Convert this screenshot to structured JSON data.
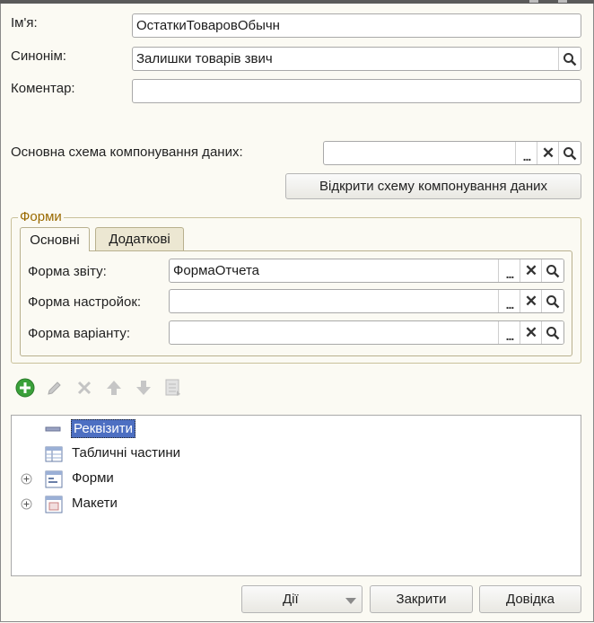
{
  "form": {
    "name_label": "Ім'я:",
    "name_value": "ОстаткиТоваровОбычн",
    "synonym_label": "Синонім:",
    "synonym_value": "Залишки товарів звич",
    "comment_label": "Коментар:",
    "comment_value": "",
    "schema_label": "Основна схема компонування даних:",
    "schema_value": "",
    "open_schema_button": "Відкрити схему компонування даних"
  },
  "forms_group": {
    "title": "Форми",
    "tabs": [
      {
        "label": "Основні",
        "active": true
      },
      {
        "label": "Додаткові",
        "active": false
      }
    ],
    "fields": [
      {
        "label": "Форма звіту:",
        "value": "ФормаОтчета"
      },
      {
        "label": "Форма настройок:",
        "value": ""
      },
      {
        "label": "Форма варіанту:",
        "value": ""
      }
    ]
  },
  "toolbar": {
    "icons": [
      "add-icon",
      "edit-icon",
      "delete-icon",
      "move-up-icon",
      "move-down-icon",
      "sort-icon"
    ]
  },
  "tree": {
    "items": [
      {
        "label": "Реквізити",
        "selected": true,
        "expandable": false
      },
      {
        "label": "Табличні частини",
        "selected": false,
        "expandable": false
      },
      {
        "label": "Форми",
        "selected": false,
        "expandable": true
      },
      {
        "label": "Макети",
        "selected": false,
        "expandable": true
      }
    ]
  },
  "buttons": {
    "actions": "Дії",
    "close": "Закрити",
    "help": "Довідка"
  },
  "colors": {
    "background": "#fbfaf3",
    "accent_title": "#9a6a00",
    "selection": "#4d6fc2",
    "add_green": "#3aa03a"
  }
}
